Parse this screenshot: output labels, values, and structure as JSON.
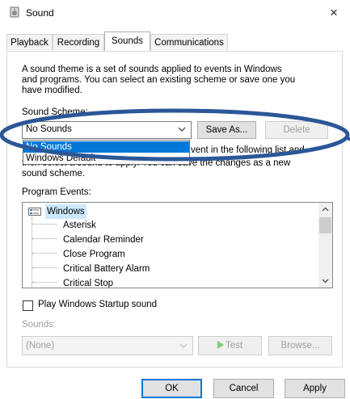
{
  "window": {
    "title": "Sound",
    "close_glyph": "×"
  },
  "tabs": [
    {
      "label": "Playback"
    },
    {
      "label": "Recording"
    },
    {
      "label": "Sounds"
    },
    {
      "label": "Communications"
    }
  ],
  "sounds_tab": {
    "description_lines": [
      "A sound theme is a set of sounds applied to events in Windows",
      "and programs.  You can select an existing scheme or save one you",
      "have modified."
    ],
    "scheme_label": "Sound Scheme:",
    "scheme_value": "No Sounds",
    "save_as_label": "Save As...",
    "delete_label": "Delete",
    "dropdown_options": [
      "No Sounds",
      "Windows Default"
    ],
    "desc2_line1": "vent in the following list and",
    "desc2_line2": "then select a sound to apply. You can save the changes as a new",
    "desc2_line3": "sound scheme.",
    "program_events_label": "Program Events:",
    "events_root": "Windows",
    "events": [
      "Asterisk",
      "Calendar Reminder",
      "Close Program",
      "Critical Battery Alarm",
      "Critical Stop"
    ],
    "startup_checkbox_label": "Play Windows Startup sound",
    "startup_checked": false,
    "sounds_label": "Sounds:",
    "sounds_value": "(None)",
    "test_label": "Test",
    "browse_label": "Browse..."
  },
  "footer": {
    "ok_label": "OK",
    "cancel_label": "Cancel",
    "apply_label": "Apply"
  },
  "colors": {
    "selection": "#0078d7",
    "tree_highlight": "#cce8ff",
    "annotation": "#2b5797"
  },
  "icons": [
    "speaker-icon",
    "close-icon",
    "chevron-down-icon",
    "windows-icon",
    "scroll-up-icon",
    "scroll-down-icon",
    "play-icon"
  ]
}
